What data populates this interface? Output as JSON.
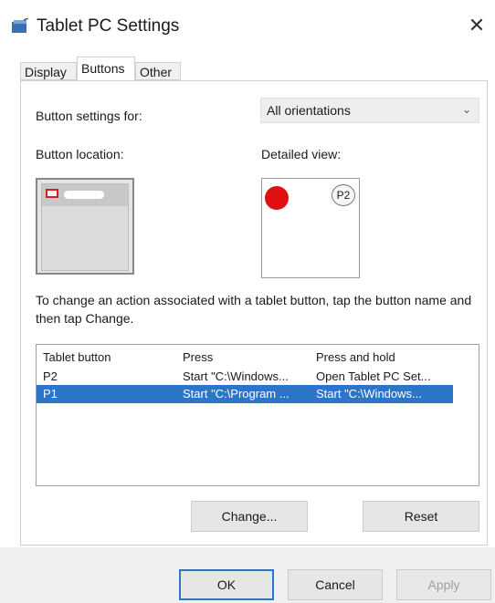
{
  "window": {
    "title": "Tablet PC Settings",
    "close_glyph": "✕",
    "icon": "tablet-pc-icon"
  },
  "tabs": [
    {
      "label": "Display",
      "active": false
    },
    {
      "label": "Buttons",
      "active": true
    },
    {
      "label": "Other",
      "active": false
    }
  ],
  "button_settings": {
    "label": "Button settings for:",
    "selected": "All orientations",
    "chevron": "⌄"
  },
  "button_location": {
    "label": "Button location:"
  },
  "detailed_view": {
    "label": "Detailed view:",
    "badge": "P2"
  },
  "instructions": "To change an action associated with a tablet button, tap the button name and then tap Change.",
  "list": {
    "columns": [
      "Tablet button",
      "Press",
      "Press and hold"
    ],
    "rows": [
      {
        "button": "P2",
        "press": "Start \"C:\\Windows...",
        "hold": "Open Tablet PC Set...",
        "selected": false
      },
      {
        "button": "P1",
        "press": "Start \"C:\\Program ...",
        "hold": "Start \"C:\\Windows...",
        "selected": true
      }
    ]
  },
  "actions": {
    "change": "Change...",
    "reset": "Reset"
  },
  "footer": {
    "ok": "OK",
    "cancel": "Cancel",
    "apply": "Apply"
  },
  "colors": {
    "selection": "#2d75c7",
    "accent_red": "#e01010"
  }
}
